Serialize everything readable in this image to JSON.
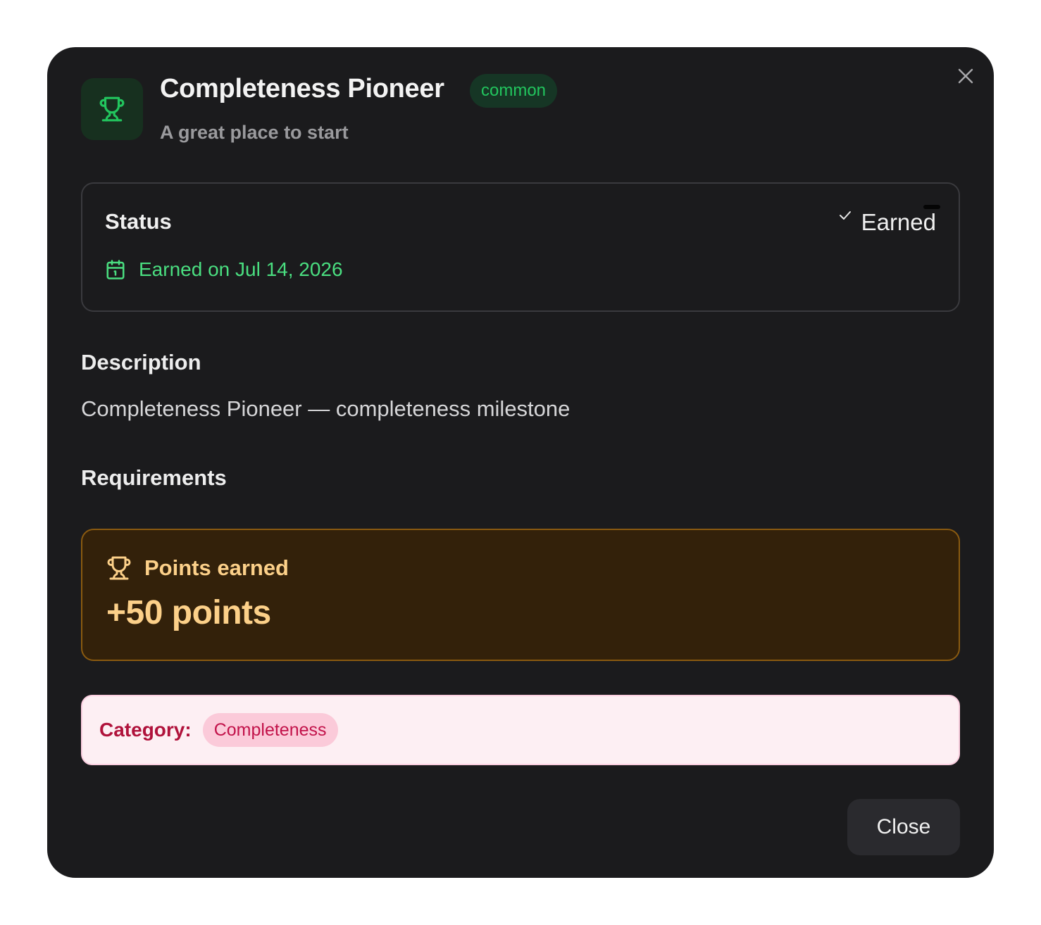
{
  "achievement": {
    "title": "Completeness Pioneer",
    "rarity": "common",
    "subtitle": "A great place to start",
    "icon": "trophy-icon"
  },
  "status": {
    "label": "Status",
    "state": "Earned",
    "earned_on": "Earned on Jul 14, 2026"
  },
  "description": {
    "heading": "Description",
    "text": "Completeness Pioneer — completeness milestone"
  },
  "requirements": {
    "heading": "Requirements"
  },
  "points": {
    "label": "Points earned",
    "value": "+50 points"
  },
  "category": {
    "label": "Category:",
    "value": "Completeness"
  },
  "actions": {
    "close_label": "Close"
  },
  "colors": {
    "modal_bg": "#1b1b1d",
    "rarity_green": "#22c55e",
    "earned_green": "#4ade80",
    "points_amber": "#fcd089",
    "category_red": "#b0123b"
  }
}
